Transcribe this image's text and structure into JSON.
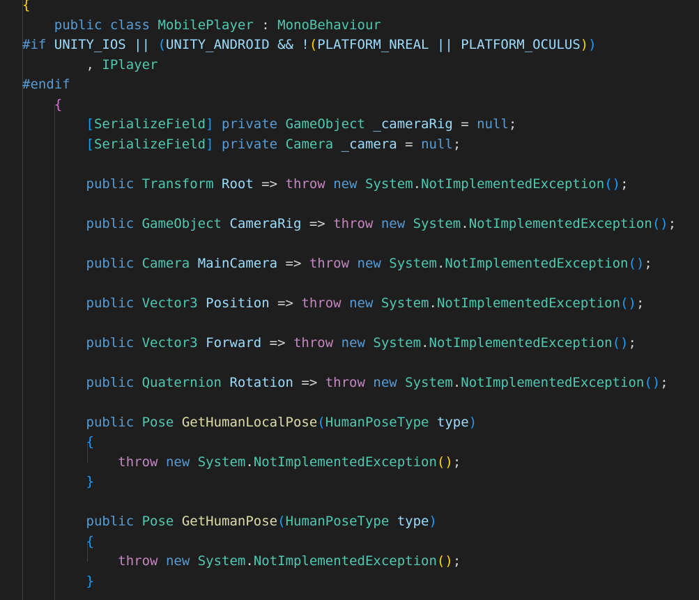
{
  "editor": {
    "background": "#1e1e1e",
    "indent_guide_color": "#404040",
    "colors": {
      "keyword": "#569cd6",
      "control_keyword": "#c586c0",
      "type": "#4ec9b0",
      "identifier": "#9cdcfe",
      "method": "#dcdcaa",
      "plain": "#d4d4d4",
      "bracket_level1": "#ffd700",
      "bracket_level2": "#da70d6",
      "bracket_level3": "#179fff"
    },
    "lines": [
      [
        {
          "t": "{",
          "c": "b1"
        }
      ],
      [
        {
          "t": "    ",
          "c": "txt"
        },
        {
          "t": "public",
          "c": "kw"
        },
        {
          "t": " ",
          "c": "txt"
        },
        {
          "t": "class",
          "c": "kw"
        },
        {
          "t": " ",
          "c": "txt"
        },
        {
          "t": "MobilePlayer",
          "c": "type"
        },
        {
          "t": " : ",
          "c": "txt"
        },
        {
          "t": "MonoBehaviour",
          "c": "type"
        }
      ],
      [
        {
          "t": "#if",
          "c": "ppkw"
        },
        {
          "t": " UNITY_IOS || ",
          "c": "var"
        },
        {
          "t": "(",
          "c": "b3"
        },
        {
          "t": "UNITY_ANDROID && !",
          "c": "var"
        },
        {
          "t": "(",
          "c": "b1"
        },
        {
          "t": "PLATFORM_NREAL || PLATFORM_OCULUS",
          "c": "var"
        },
        {
          "t": ")",
          "c": "b1"
        },
        {
          "t": ")",
          "c": "b3"
        }
      ],
      [
        {
          "t": "        , ",
          "c": "txt"
        },
        {
          "t": "IPlayer",
          "c": "type"
        }
      ],
      [
        {
          "t": "#endif",
          "c": "ppkw"
        }
      ],
      [
        {
          "t": "    ",
          "c": "txt"
        },
        {
          "t": "{",
          "c": "b2"
        }
      ],
      [
        {
          "t": "        ",
          "c": "txt"
        },
        {
          "t": "[",
          "c": "b3"
        },
        {
          "t": "SerializeField",
          "c": "type"
        },
        {
          "t": "]",
          "c": "b3"
        },
        {
          "t": " ",
          "c": "txt"
        },
        {
          "t": "private",
          "c": "kw"
        },
        {
          "t": " ",
          "c": "txt"
        },
        {
          "t": "GameObject",
          "c": "type"
        },
        {
          "t": " ",
          "c": "txt"
        },
        {
          "t": "_cameraRig",
          "c": "var"
        },
        {
          "t": " = ",
          "c": "txt"
        },
        {
          "t": "null",
          "c": "kw"
        },
        {
          "t": ";",
          "c": "txt"
        }
      ],
      [
        {
          "t": "        ",
          "c": "txt"
        },
        {
          "t": "[",
          "c": "b3"
        },
        {
          "t": "SerializeField",
          "c": "type"
        },
        {
          "t": "]",
          "c": "b3"
        },
        {
          "t": " ",
          "c": "txt"
        },
        {
          "t": "private",
          "c": "kw"
        },
        {
          "t": " ",
          "c": "txt"
        },
        {
          "t": "Camera",
          "c": "type"
        },
        {
          "t": " ",
          "c": "txt"
        },
        {
          "t": "_camera",
          "c": "var"
        },
        {
          "t": " = ",
          "c": "txt"
        },
        {
          "t": "null",
          "c": "kw"
        },
        {
          "t": ";",
          "c": "txt"
        }
      ],
      [],
      [
        {
          "t": "        ",
          "c": "txt"
        },
        {
          "t": "public",
          "c": "kw"
        },
        {
          "t": " ",
          "c": "txt"
        },
        {
          "t": "Transform",
          "c": "type"
        },
        {
          "t": " ",
          "c": "txt"
        },
        {
          "t": "Root",
          "c": "var"
        },
        {
          "t": " => ",
          "c": "txt"
        },
        {
          "t": "throw",
          "c": "kw2"
        },
        {
          "t": " ",
          "c": "txt"
        },
        {
          "t": "new",
          "c": "kw"
        },
        {
          "t": " ",
          "c": "txt"
        },
        {
          "t": "System",
          "c": "type"
        },
        {
          "t": ".",
          "c": "txt"
        },
        {
          "t": "NotImplementedException",
          "c": "type"
        },
        {
          "t": "(",
          "c": "b3"
        },
        {
          "t": ")",
          "c": "b3"
        },
        {
          "t": ";",
          "c": "txt"
        }
      ],
      [],
      [
        {
          "t": "        ",
          "c": "txt"
        },
        {
          "t": "public",
          "c": "kw"
        },
        {
          "t": " ",
          "c": "txt"
        },
        {
          "t": "GameObject",
          "c": "type"
        },
        {
          "t": " ",
          "c": "txt"
        },
        {
          "t": "CameraRig",
          "c": "var"
        },
        {
          "t": " => ",
          "c": "txt"
        },
        {
          "t": "throw",
          "c": "kw2"
        },
        {
          "t": " ",
          "c": "txt"
        },
        {
          "t": "new",
          "c": "kw"
        },
        {
          "t": " ",
          "c": "txt"
        },
        {
          "t": "System",
          "c": "type"
        },
        {
          "t": ".",
          "c": "txt"
        },
        {
          "t": "NotImplementedException",
          "c": "type"
        },
        {
          "t": "(",
          "c": "b3"
        },
        {
          "t": ")",
          "c": "b3"
        },
        {
          "t": ";",
          "c": "txt"
        }
      ],
      [],
      [
        {
          "t": "        ",
          "c": "txt"
        },
        {
          "t": "public",
          "c": "kw"
        },
        {
          "t": " ",
          "c": "txt"
        },
        {
          "t": "Camera",
          "c": "type"
        },
        {
          "t": " ",
          "c": "txt"
        },
        {
          "t": "MainCamera",
          "c": "var"
        },
        {
          "t": " => ",
          "c": "txt"
        },
        {
          "t": "throw",
          "c": "kw2"
        },
        {
          "t": " ",
          "c": "txt"
        },
        {
          "t": "new",
          "c": "kw"
        },
        {
          "t": " ",
          "c": "txt"
        },
        {
          "t": "System",
          "c": "type"
        },
        {
          "t": ".",
          "c": "txt"
        },
        {
          "t": "NotImplementedException",
          "c": "type"
        },
        {
          "t": "(",
          "c": "b3"
        },
        {
          "t": ")",
          "c": "b3"
        },
        {
          "t": ";",
          "c": "txt"
        }
      ],
      [],
      [
        {
          "t": "        ",
          "c": "txt"
        },
        {
          "t": "public",
          "c": "kw"
        },
        {
          "t": " ",
          "c": "txt"
        },
        {
          "t": "Vector3",
          "c": "type"
        },
        {
          "t": " ",
          "c": "txt"
        },
        {
          "t": "Position",
          "c": "var"
        },
        {
          "t": " => ",
          "c": "txt"
        },
        {
          "t": "throw",
          "c": "kw2"
        },
        {
          "t": " ",
          "c": "txt"
        },
        {
          "t": "new",
          "c": "kw"
        },
        {
          "t": " ",
          "c": "txt"
        },
        {
          "t": "System",
          "c": "type"
        },
        {
          "t": ".",
          "c": "txt"
        },
        {
          "t": "NotImplementedException",
          "c": "type"
        },
        {
          "t": "(",
          "c": "b3"
        },
        {
          "t": ")",
          "c": "b3"
        },
        {
          "t": ";",
          "c": "txt"
        }
      ],
      [],
      [
        {
          "t": "        ",
          "c": "txt"
        },
        {
          "t": "public",
          "c": "kw"
        },
        {
          "t": " ",
          "c": "txt"
        },
        {
          "t": "Vector3",
          "c": "type"
        },
        {
          "t": " ",
          "c": "txt"
        },
        {
          "t": "Forward",
          "c": "var"
        },
        {
          "t": " => ",
          "c": "txt"
        },
        {
          "t": "throw",
          "c": "kw2"
        },
        {
          "t": " ",
          "c": "txt"
        },
        {
          "t": "new",
          "c": "kw"
        },
        {
          "t": " ",
          "c": "txt"
        },
        {
          "t": "System",
          "c": "type"
        },
        {
          "t": ".",
          "c": "txt"
        },
        {
          "t": "NotImplementedException",
          "c": "type"
        },
        {
          "t": "(",
          "c": "b3"
        },
        {
          "t": ")",
          "c": "b3"
        },
        {
          "t": ";",
          "c": "txt"
        }
      ],
      [],
      [
        {
          "t": "        ",
          "c": "txt"
        },
        {
          "t": "public",
          "c": "kw"
        },
        {
          "t": " ",
          "c": "txt"
        },
        {
          "t": "Quaternion",
          "c": "type"
        },
        {
          "t": " ",
          "c": "txt"
        },
        {
          "t": "Rotation",
          "c": "var"
        },
        {
          "t": " => ",
          "c": "txt"
        },
        {
          "t": "throw",
          "c": "kw2"
        },
        {
          "t": " ",
          "c": "txt"
        },
        {
          "t": "new",
          "c": "kw"
        },
        {
          "t": " ",
          "c": "txt"
        },
        {
          "t": "System",
          "c": "type"
        },
        {
          "t": ".",
          "c": "txt"
        },
        {
          "t": "NotImplementedException",
          "c": "type"
        },
        {
          "t": "(",
          "c": "b3"
        },
        {
          "t": ")",
          "c": "b3"
        },
        {
          "t": ";",
          "c": "txt"
        }
      ],
      [],
      [
        {
          "t": "        ",
          "c": "txt"
        },
        {
          "t": "public",
          "c": "kw"
        },
        {
          "t": " ",
          "c": "txt"
        },
        {
          "t": "Pose",
          "c": "type"
        },
        {
          "t": " ",
          "c": "txt"
        },
        {
          "t": "GetHumanLocalPose",
          "c": "fn"
        },
        {
          "t": "(",
          "c": "b3"
        },
        {
          "t": "HumanPoseType",
          "c": "type"
        },
        {
          "t": " ",
          "c": "txt"
        },
        {
          "t": "type",
          "c": "var"
        },
        {
          "t": ")",
          "c": "b3"
        }
      ],
      [
        {
          "t": "        ",
          "c": "txt"
        },
        {
          "t": "{",
          "c": "b3"
        }
      ],
      [
        {
          "t": "            ",
          "c": "txt"
        },
        {
          "t": "throw",
          "c": "kw2"
        },
        {
          "t": " ",
          "c": "txt"
        },
        {
          "t": "new",
          "c": "kw"
        },
        {
          "t": " ",
          "c": "txt"
        },
        {
          "t": "System",
          "c": "type"
        },
        {
          "t": ".",
          "c": "txt"
        },
        {
          "t": "NotImplementedException",
          "c": "type"
        },
        {
          "t": "(",
          "c": "b1"
        },
        {
          "t": ")",
          "c": "b1"
        },
        {
          "t": ";",
          "c": "txt"
        }
      ],
      [
        {
          "t": "        ",
          "c": "txt"
        },
        {
          "t": "}",
          "c": "b3"
        }
      ],
      [],
      [
        {
          "t": "        ",
          "c": "txt"
        },
        {
          "t": "public",
          "c": "kw"
        },
        {
          "t": " ",
          "c": "txt"
        },
        {
          "t": "Pose",
          "c": "type"
        },
        {
          "t": " ",
          "c": "txt"
        },
        {
          "t": "GetHumanPose",
          "c": "fn"
        },
        {
          "t": "(",
          "c": "b3"
        },
        {
          "t": "HumanPoseType",
          "c": "type"
        },
        {
          "t": " ",
          "c": "txt"
        },
        {
          "t": "type",
          "c": "var"
        },
        {
          "t": ")",
          "c": "b3"
        }
      ],
      [
        {
          "t": "        ",
          "c": "txt"
        },
        {
          "t": "{",
          "c": "b3"
        }
      ],
      [
        {
          "t": "            ",
          "c": "txt"
        },
        {
          "t": "throw",
          "c": "kw2"
        },
        {
          "t": " ",
          "c": "txt"
        },
        {
          "t": "new",
          "c": "kw"
        },
        {
          "t": " ",
          "c": "txt"
        },
        {
          "t": "System",
          "c": "type"
        },
        {
          "t": ".",
          "c": "txt"
        },
        {
          "t": "NotImplementedException",
          "c": "type"
        },
        {
          "t": "(",
          "c": "b1"
        },
        {
          "t": ")",
          "c": "b1"
        },
        {
          "t": ";",
          "c": "txt"
        }
      ],
      [
        {
          "t": "        ",
          "c": "txt"
        },
        {
          "t": "}",
          "c": "b3"
        }
      ],
      []
    ]
  }
}
